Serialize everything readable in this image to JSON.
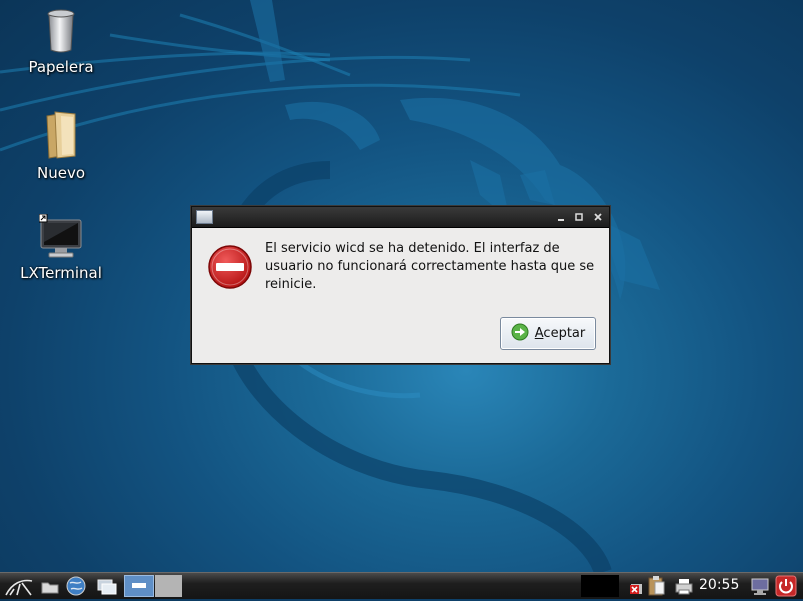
{
  "desktop": {
    "icons": [
      {
        "label": "Papelera",
        "icon": "trash-icon"
      },
      {
        "label": "Nuevo",
        "icon": "folder-icon"
      },
      {
        "label": "LXTerminal",
        "icon": "terminal-icon"
      }
    ]
  },
  "dialog": {
    "icon": "error-stop-icon",
    "message": "El servicio  wicd se ha detenido. El interfaz de usuario no funcionará correctamente hasta que se reinicie.",
    "ok_label_underlined": "A",
    "ok_label_rest": "ceptar"
  },
  "taskbar": {
    "clock": "20:55",
    "colors": {
      "bar": "#1e1e1e",
      "active_task": "#5f8fc6"
    }
  }
}
